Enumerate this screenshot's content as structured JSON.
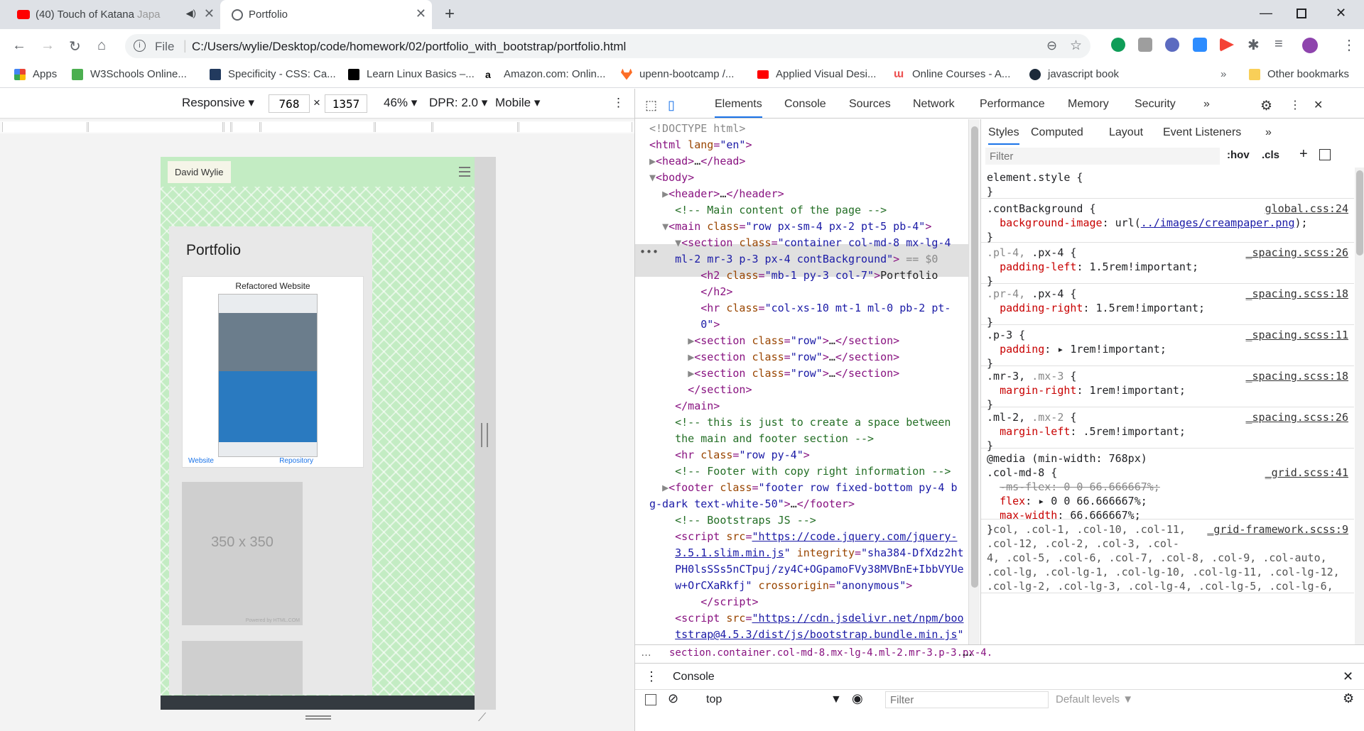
{
  "browser": {
    "tabs": [
      {
        "title": "(40) Touch of Katana",
        "title_tail": "Japa"
      },
      {
        "title": "Portfolio"
      }
    ],
    "address": {
      "scheme": "File",
      "url": "C:/Users/wylie/Desktop/code/homework/02/portfolio_with_bootstrap/portfolio.html"
    },
    "bookmarks": [
      {
        "label": "Apps",
        "color": "#4285f4"
      },
      {
        "label": "W3Schools Online...",
        "color": "#4caf50"
      },
      {
        "label": "Specificity - CSS: Ca...",
        "color": "#223a5e"
      },
      {
        "label": "Learn Linux Basics –...",
        "color": "#000000"
      },
      {
        "label": "Amazon.com: Onlin...",
        "color": "#ff9900"
      },
      {
        "label": "upenn-bootcamp /...",
        "color": "#fc6d26"
      },
      {
        "label": "Applied Visual Desi...",
        "color": "#ff0000"
      },
      {
        "label": "Online Courses - A...",
        "color": "#ec5252"
      },
      {
        "label": "javascript book",
        "color": "#1c2a3a"
      }
    ],
    "bookmarks_more": "»",
    "other_bookmarks": "Other bookmarks"
  },
  "device_toolbar": {
    "mode": "Responsive",
    "width": "768",
    "times": "×",
    "height": "1357",
    "zoom": "46%",
    "dpr": "DPR: 2.0",
    "type": "Mobile"
  },
  "page": {
    "brand": "David Wylie",
    "heading": "Portfolio",
    "project_title": "Refactored Website",
    "link_website": "Website",
    "link_repo": "Repository",
    "placeholder": "350 x 350",
    "powered": "Powered by HTML.COM"
  },
  "devtools": {
    "tabs": [
      "Elements",
      "Console",
      "Sources",
      "Network",
      "Performance",
      "Memory",
      "Security"
    ],
    "more": "»",
    "styles_tabs": [
      "Styles",
      "Computed",
      "Layout",
      "Event Listeners"
    ],
    "filter_placeholder": "Filter",
    "hov": ":hov",
    "cls": ".cls",
    "breadcrumb": "section.container.col-md-8.mx-lg-4.ml-2.mr-3.p-3.px-4.",
    "drawer_title": "Console",
    "context": "top",
    "console_filter": "Filter",
    "levels": "Default levels ▼"
  }
}
